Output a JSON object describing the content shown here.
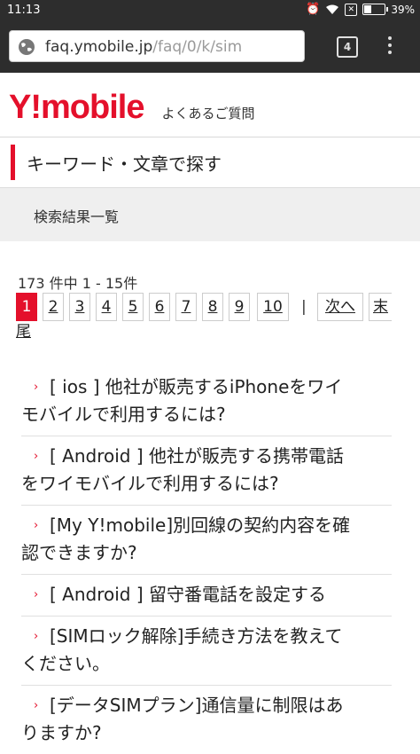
{
  "status_bar": {
    "time": "11:13",
    "battery": "39%",
    "battery_level": 0.39,
    "icons": [
      "alarm-icon",
      "wifi-icon",
      "no-sim-icon",
      "battery-icon"
    ]
  },
  "browser": {
    "url_host": "faq.ymobile.jp",
    "url_path": "/faq/0/k/sim",
    "tab_count": "4"
  },
  "header": {
    "logo": "Y!mobile",
    "subtitle": "よくあるご質問"
  },
  "keyword_title": "キーワード・文章で探す",
  "results_heading": "検索結果一覧",
  "results_count": "173 件中 1 - 15件",
  "pagination": {
    "pages": [
      "1",
      "2",
      "3",
      "4",
      "5",
      "6",
      "7",
      "8",
      "9",
      "10"
    ],
    "current": "1",
    "separator": "|",
    "next": "次へ",
    "last_part1": "末",
    "last_part2": "尾"
  },
  "faq_items": [
    {
      "line1": "[ ios ] 他社が販売するiPhoneをワイ",
      "line2": "モバイルで利用するには?"
    },
    {
      "line1": "[ Android ] 他社が販売する携帯電話",
      "line2": "をワイモバイルで利用するには?"
    },
    {
      "line1": "[My Y!mobile]別回線の契約内容を確",
      "line2": "認できますか?"
    },
    {
      "line1": "[ Android ] 留守番電話を設定する",
      "line2": ""
    },
    {
      "line1": "[SIMロック解除]手続き方法を教えて",
      "line2": "ください。"
    },
    {
      "line1": "[データSIMプラン]通信量に制限はあ",
      "line2": "りますか?"
    }
  ],
  "colors": {
    "brand_red": "#e4102b",
    "chrome_dark": "#2d2d2d",
    "section_gray": "#efefef"
  }
}
